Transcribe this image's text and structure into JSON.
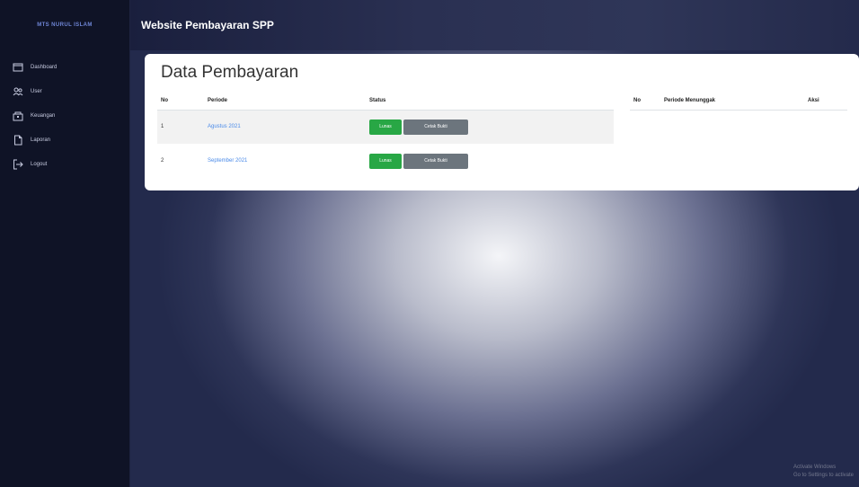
{
  "sidebar": {
    "brand": "MTS NURUL ISLAM",
    "items": [
      {
        "label": "Dashboard",
        "icon": "dashboard-icon"
      },
      {
        "label": "User",
        "icon": "users-icon"
      },
      {
        "label": "Keuangan",
        "icon": "wallet-icon"
      },
      {
        "label": "Laporan",
        "icon": "document-icon"
      },
      {
        "label": "Logout",
        "icon": "logout-icon"
      }
    ]
  },
  "header": {
    "title": "Website Pembayaran SPP"
  },
  "card": {
    "title": "Data Pembayaran",
    "table": {
      "headers": [
        "No",
        "Periode",
        "Status"
      ],
      "rows": [
        {
          "no": "1",
          "periode": "Agustus 2021",
          "status_button": "Lunas",
          "action_button": "Cetak Bukti"
        },
        {
          "no": "2",
          "periode": "September 2021",
          "status_button": "Lunas",
          "action_button": "Cetak Bukti"
        }
      ]
    },
    "side_table": {
      "headers": [
        "No",
        "Periode Menunggak",
        "Aksi"
      ]
    }
  },
  "watermark": {
    "line1": "Activate Windows",
    "line2": "Go to Settings to activate"
  },
  "colors": {
    "sidebar_bg": "#0f1326",
    "success": "#28a745",
    "secondary": "#6c757d",
    "link": "#4a8ae8"
  }
}
